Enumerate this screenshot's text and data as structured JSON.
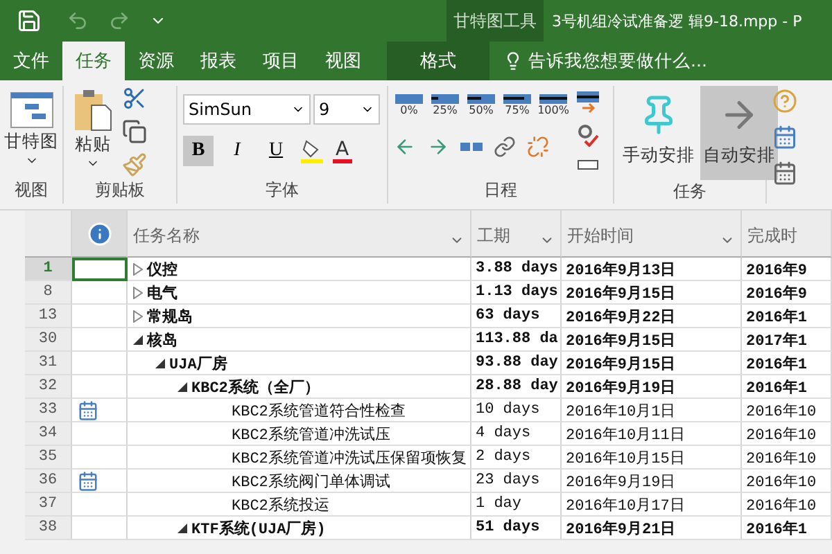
{
  "title_bar": {
    "context_label": "甘特图工具",
    "title": "3号机组冷试准备逻 辑9-18.mpp - P"
  },
  "tabs": [
    {
      "label": "文件",
      "selected": false,
      "contextual": false
    },
    {
      "label": "任务",
      "selected": true,
      "contextual": false
    },
    {
      "label": "资源",
      "selected": false,
      "contextual": false
    },
    {
      "label": "报表",
      "selected": false,
      "contextual": false
    },
    {
      "label": "项目",
      "selected": false,
      "contextual": false
    },
    {
      "label": "视图",
      "selected": false,
      "contextual": false
    },
    {
      "label": "格式",
      "selected": false,
      "contextual": true
    }
  ],
  "tell_me": {
    "placeholder": "告诉我您想要做什么..."
  },
  "ribbon": {
    "view": {
      "label": "视图",
      "gantt": "甘特图"
    },
    "clipboard": {
      "label": "剪贴板",
      "paste": "粘贴"
    },
    "font": {
      "label": "字体",
      "family": "SimSun",
      "size": "9",
      "styles": [
        {
          "label": "B",
          "kind": "bold",
          "on": true
        },
        {
          "label": "I",
          "kind": "italic",
          "on": false
        },
        {
          "label": "U",
          "kind": "underline",
          "on": false
        }
      ],
      "color_letter": "A"
    },
    "schedule": {
      "label": "日程",
      "percents": [
        "0%",
        "25%",
        "50%",
        "75%",
        "100%"
      ]
    },
    "tasks": {
      "label": "任务",
      "modes": [
        {
          "label": "手动安排",
          "selected": false
        },
        {
          "label": "自动安排",
          "selected": true
        }
      ]
    }
  },
  "table": {
    "columns": [
      "任务名称",
      "工期",
      "开始时间",
      "完成时"
    ],
    "rows": [
      {
        "id": "1",
        "name": "仪控",
        "duration": "3.88 days",
        "start": "2016年9月13日",
        "finish": "2016年9",
        "summary": true,
        "expanded": false,
        "selected": true
      },
      {
        "id": "8",
        "name": "电气",
        "duration": "1.13 days",
        "start": "2016年9月15日",
        "finish": "2016年9",
        "summary": true,
        "expanded": false,
        "selected": false
      },
      {
        "id": "13",
        "name": "常规岛",
        "duration": "63 days",
        "start": "2016年9月22日",
        "finish": "2016年1",
        "summary": true,
        "expanded": false,
        "selected": false
      },
      {
        "id": "30",
        "name": "核岛",
        "duration": "113.88 da",
        "start": "2016年9月15日",
        "finish": "2017年1",
        "summary": true,
        "expanded": true,
        "selected": false,
        "children": [
          {
            "id": "31",
            "name": "UJA厂房",
            "duration": "93.88 day",
            "start": "2016年9月15日",
            "finish": "2016年1",
            "summary": true,
            "expanded": true,
            "selected": false,
            "children": [
              {
                "id": "32",
                "name": "KBC2系统（全厂）",
                "duration": "28.88 day",
                "start": "2016年9月19日",
                "finish": "2016年1",
                "summary": true,
                "expanded": true,
                "selected": false,
                "children": [
                  {
                    "id": "33",
                    "name": "KBC2系统管道符合性检查",
                    "duration": "10 days",
                    "start": "2016年10月1日",
                    "finish": "2016年10",
                    "summary": false,
                    "selected": false,
                    "calendar": true
                  },
                  {
                    "id": "34",
                    "name": "KBC2系统管道冲洗试压",
                    "duration": "4 days",
                    "start": "2016年10月11日",
                    "finish": "2016年10",
                    "summary": false,
                    "selected": false
                  },
                  {
                    "id": "35",
                    "name": "KBC2系统管道冲洗试压保留项恢复",
                    "duration": "2 days",
                    "start": "2016年10月15日",
                    "finish": "2016年10",
                    "summary": false,
                    "selected": false
                  },
                  {
                    "id": "36",
                    "name": "KBC2系统阀门单体调试",
                    "duration": "23 days",
                    "start": "2016年9月19日",
                    "finish": "2016年10",
                    "summary": false,
                    "selected": false,
                    "calendar": true
                  },
                  {
                    "id": "37",
                    "name": "KBC2系统投运",
                    "duration": "1 day",
                    "start": "2016年10月17日",
                    "finish": "2016年10",
                    "summary": false,
                    "selected": false
                  }
                ]
              },
              {
                "id": "38",
                "name": "KTF系统(UJA厂房)",
                "duration": "51 days",
                "start": "2016年9月21日",
                "finish": "2016年1",
                "summary": true,
                "expanded": true,
                "selected": false
              }
            ]
          }
        ]
      }
    ]
  }
}
